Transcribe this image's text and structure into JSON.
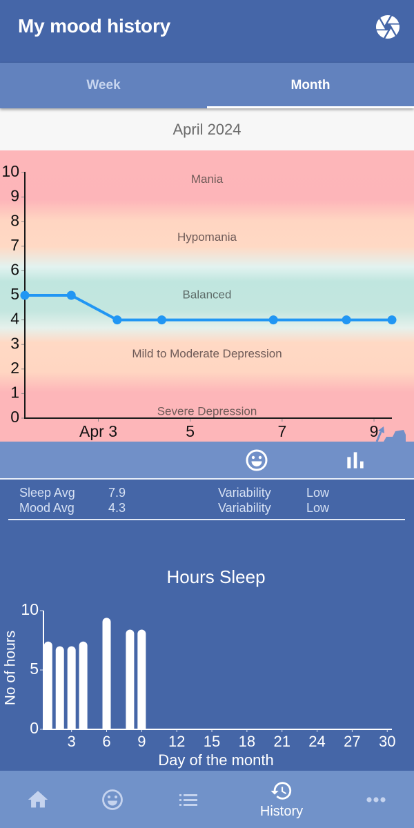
{
  "header": {
    "title": "My mood history",
    "action_icon": "camera-aperture-icon"
  },
  "tabs": [
    {
      "label": "Week",
      "active": false
    },
    {
      "label": "Month",
      "active": true
    }
  ],
  "period_label": "April 2024",
  "view_toggle": [
    {
      "icon": "smiley-icon",
      "active": true
    },
    {
      "icon": "bar-chart-icon",
      "active": false
    }
  ],
  "stats": {
    "rows": [
      {
        "label": "Sleep Avg",
        "value": "7.9",
        "variability_label": "Variability",
        "variability_value": "Low"
      },
      {
        "label": "Mood Avg",
        "value": "4.3",
        "variability_label": "Variability",
        "variability_value": "Low"
      }
    ]
  },
  "chart_data": [
    {
      "type": "line",
      "title": "",
      "xlabel": "",
      "ylabel": "",
      "x_unit": "day of April 2024",
      "x": [
        1.4,
        2.41,
        3.41,
        4.38,
        6.81,
        8.4,
        9.39
      ],
      "y": [
        5,
        5,
        4,
        4,
        4,
        4,
        4
      ],
      "xlim": [
        1.4,
        9.39
      ],
      "ylim": [
        0,
        10
      ],
      "x_ticks": [
        3,
        5,
        7,
        9
      ],
      "x_tick_labels": [
        "Apr 3",
        "5",
        "7",
        "9"
      ],
      "y_ticks": [
        0,
        1,
        2,
        3,
        4,
        5,
        6,
        7,
        8,
        9,
        10
      ],
      "grid": false,
      "legend": "none",
      "series_color": "#2196F3",
      "bands": [
        {
          "label": "Mania",
          "label_value": 9.7,
          "color": "#FDB6B9"
        },
        {
          "label": "Hypomania",
          "label_value": 7.35,
          "color": "#FFD8C3"
        },
        {
          "label": "Balanced",
          "label_value": 5.0,
          "color": "#C0E6DF"
        },
        {
          "label": "Mild to Moderate Depression",
          "label_value": 2.6,
          "color": "#FFD8C3"
        },
        {
          "label": "Severe Depression",
          "label_value": 0.25,
          "color": "#FDB6B9"
        }
      ]
    },
    {
      "type": "bar",
      "title": "Hours Sleep",
      "xlabel": "Day of the month",
      "ylabel": "No of hours",
      "x": [
        1,
        2,
        3,
        4,
        6,
        8,
        9
      ],
      "values": [
        7.4,
        7.0,
        7.0,
        7.4,
        9.4,
        8.4,
        8.4
      ],
      "xlim": [
        0.6,
        30.4
      ],
      "ylim": [
        0,
        10
      ],
      "x_ticks": [
        3,
        6,
        9,
        12,
        15,
        18,
        21,
        24,
        27,
        30
      ],
      "y_ticks": [
        0,
        5,
        10
      ],
      "grid": false,
      "legend": "none",
      "bar_color": "#FFFFFF"
    }
  ],
  "bottom_nav": [
    {
      "icon": "home-icon",
      "label": "",
      "active": false
    },
    {
      "icon": "smiley-icon",
      "label": "",
      "active": false
    },
    {
      "icon": "list-icon",
      "label": "",
      "active": false
    },
    {
      "icon": "history-icon",
      "label": "History",
      "active": true
    },
    {
      "icon": "more-icon",
      "label": "",
      "active": false
    }
  ],
  "colors": {
    "header": "#4566A8",
    "tab_bar": "#6282BE",
    "accent_line": "#2196F3",
    "inactive_icon": "#C5D3EE",
    "panel": "#4566A7"
  }
}
